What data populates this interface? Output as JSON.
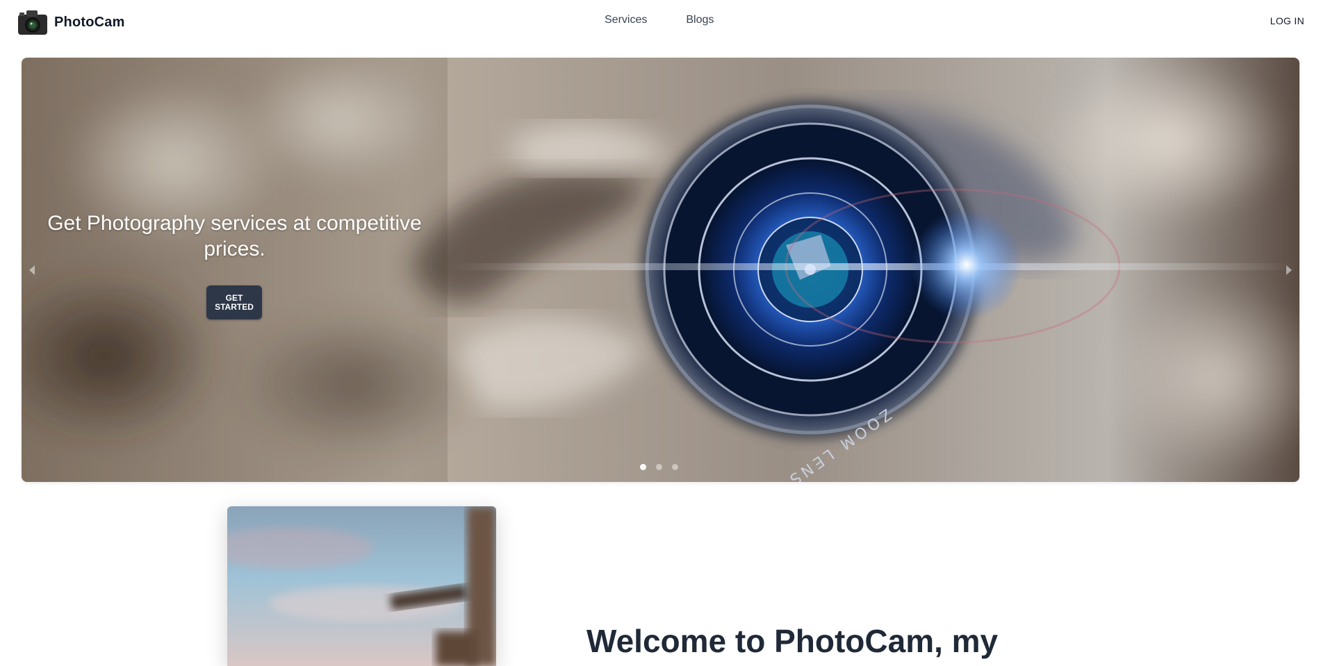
{
  "header": {
    "brand": "PhotoCam",
    "brand_icon": "camera-icon",
    "nav": [
      "Services",
      "Blogs"
    ],
    "login_label": "LOG IN"
  },
  "hero": {
    "headline": "Get Photography services at competitive prices.",
    "cta_label": "GET\nSTARTED",
    "lens_text": "ZOOM LENS",
    "slide_count": 3,
    "active_slide": 1,
    "prev_icon": "chevron-left-icon",
    "next_icon": "chevron-right-icon"
  },
  "welcome": {
    "title": "Welcome to PhotoCam, my"
  },
  "colors": {
    "cta_bg": "#2d3748",
    "text_dark": "#1f2937",
    "lens_blue": "#2f6fe0"
  }
}
